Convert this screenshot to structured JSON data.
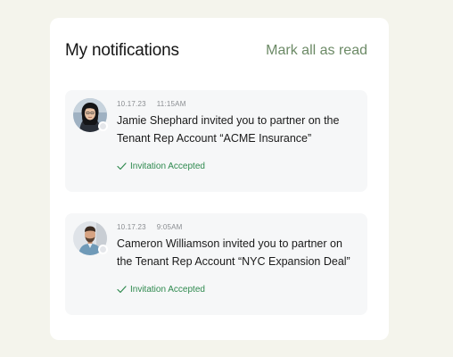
{
  "header": {
    "title": "My notifications",
    "mark_all_label": "Mark all as read"
  },
  "notifications": [
    {
      "date": "10.17.23",
      "time": "11:15AM",
      "message": "Jamie Shephard invited you to partner on the Tenant Rep Account “ACME Insurance”",
      "status": "Invitation Accepted",
      "avatar_icon": "woman-portrait"
    },
    {
      "date": "10.17.23",
      "time": "9:05AM",
      "message": "Cameron Williamson invited you to partner on the Tenant Rep Account “NYC Expansion Deal”",
      "status": "Invitation Accepted",
      "avatar_icon": "man-portrait"
    }
  ],
  "colors": {
    "background": "#f4f4ec",
    "panel": "#ffffff",
    "card": "#f6f7f8",
    "accent_mark_all": "#6c8a66",
    "status_accepted": "#2f8a4f"
  }
}
